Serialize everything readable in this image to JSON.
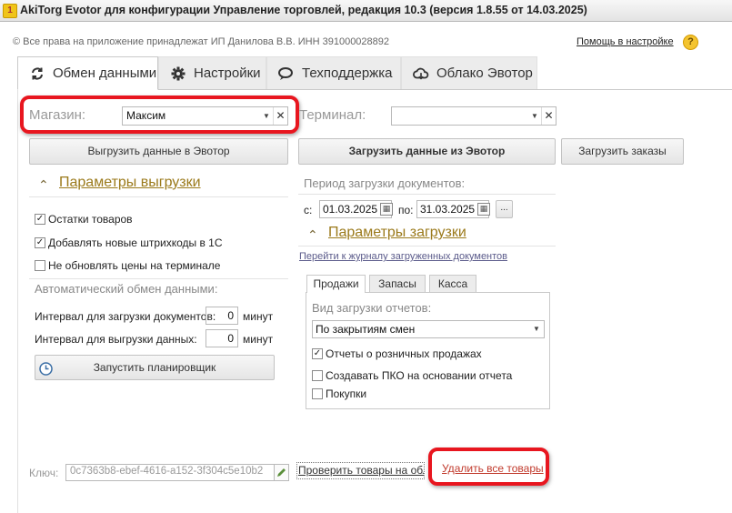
{
  "window": {
    "title": "AkiTorg Evotor для конфигурации Управление торговлей, редакция 10.3 (версия 1.8.55 от 14.03.2025)"
  },
  "header": {
    "copyright": "© Все права на приложение принадлежат ИП Данилова В.В.  ИНН 391000028892",
    "help_link": "Помощь в настройке",
    "help_icon": "?"
  },
  "tabs": [
    {
      "label": "Обмен данными",
      "icon": "sync-icon",
      "active": true
    },
    {
      "label": "Настройки",
      "icon": "gear-icon",
      "active": false
    },
    {
      "label": "Техподдержка",
      "icon": "chat-icon",
      "active": false
    },
    {
      "label": "Облако Эвотор",
      "icon": "cloud-icon",
      "active": false
    }
  ],
  "store": {
    "label": "Магазин:",
    "value": "Максим"
  },
  "terminal": {
    "label": "Терминал:",
    "value": ""
  },
  "buttons": {
    "upload": "Выгрузить данные в Эвотор",
    "download": "Загрузить данные из Эвотор",
    "orders": "Загрузить заказы",
    "scheduler": "Запустить планировщик",
    "dots": "..."
  },
  "upload_params": {
    "title": "Параметры выгрузки",
    "checkboxes": [
      {
        "label": "Остатки товаров",
        "checked": true
      },
      {
        "label": "Добавлять новые штрихкоды в 1С",
        "checked": true
      },
      {
        "label": "Не обновлять цены на терминале",
        "checked": false
      }
    ]
  },
  "auto_exchange": {
    "title": "Автоматический обмен данными:",
    "rows": [
      {
        "label": "Интервал для загрузки документов:",
        "value": "0",
        "unit": "минут"
      },
      {
        "label": "Интервал для выгрузки данных:",
        "value": "0",
        "unit": "минут"
      }
    ]
  },
  "period": {
    "title": "Период загрузки документов:",
    "from_label": "с:",
    "from": "01.03.2025",
    "to_label": "по:",
    "to": "31.03.2025"
  },
  "download_params": {
    "title": "Параметры загрузки",
    "journal_link": "Перейти к журналу загруженных документов",
    "subtabs": [
      {
        "label": "Продажи",
        "active": true
      },
      {
        "label": "Запасы",
        "active": false
      },
      {
        "label": "Касса",
        "active": false
      }
    ],
    "report_type_label": "Вид загрузки отчетов:",
    "report_type_value": "По закрытиям смен",
    "checkboxes": [
      {
        "label": "Отчеты о розничных продажах",
        "checked": true
      },
      {
        "label": "Создавать ПКО на основании отчета",
        "checked": false
      },
      {
        "label": "Покупки",
        "checked": false
      }
    ]
  },
  "footer": {
    "key_label": "Ключ:",
    "key_value": "0c7363b8-ebef-4616-a152-3f304c5e10b2",
    "check_link": "Проверить товары на облаке",
    "delete_link": "Удалить все товары"
  },
  "colors": {
    "highlight_red": "#e8161f",
    "section_gold": "#9b7a1b",
    "delete_link_red": "#c0392b"
  }
}
